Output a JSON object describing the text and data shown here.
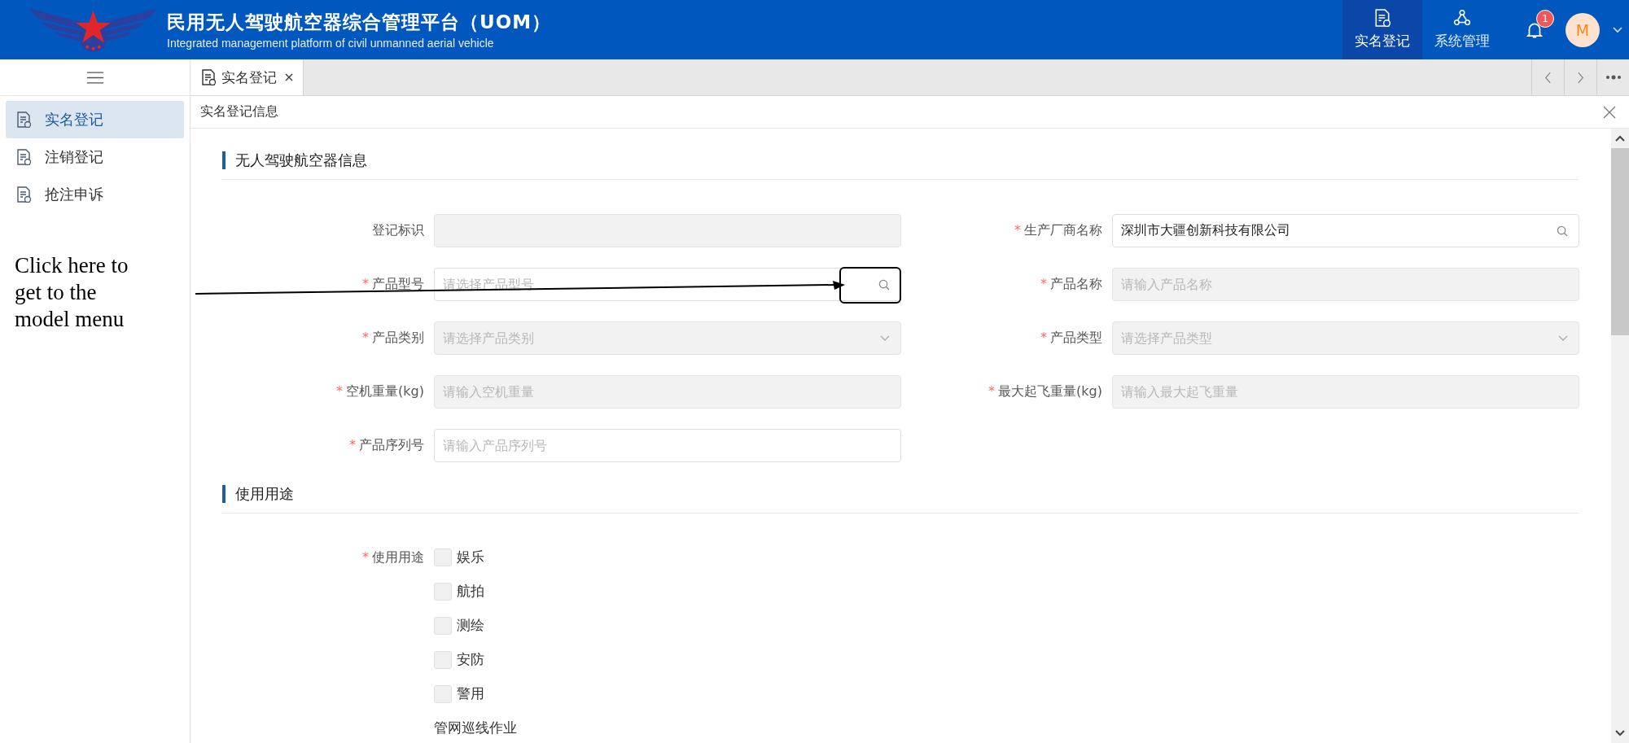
{
  "header": {
    "title": "民用无人驾驶航空器综合管理平台（UOM）",
    "subtitle": "Integrated management platform of civil unmanned aerial vehicle",
    "nav": [
      {
        "label": "实名登记",
        "selected": true,
        "kind": "document"
      },
      {
        "label": "系统管理",
        "selected": false,
        "kind": "network"
      }
    ],
    "notification_count": "1",
    "avatar": "M"
  },
  "sidebar": {
    "items": [
      {
        "label": "实名登记",
        "selected": true
      },
      {
        "label": "注销登记",
        "selected": false
      },
      {
        "label": "抢注申诉",
        "selected": false
      }
    ]
  },
  "tabs": [
    {
      "label": "实名登记",
      "selected": true
    }
  ],
  "page_title": "实名登记信息",
  "sections": [
    {
      "title": "无人驾驶航空器信息",
      "fields": [
        {
          "label": "登记标识",
          "kind": "input",
          "disabled": true
        },
        {
          "label": "生产厂商名称",
          "required_mark": "*",
          "kind": "search",
          "disabled": false,
          "value": "深圳市大疆创新科技有限公司"
        },
        {
          "label": "产品型号",
          "required_mark": "*",
          "kind": "search",
          "disabled": false,
          "placeholder": "请选择产品型号",
          "highlighted": true
        },
        {
          "label": "产品名称",
          "required_mark": "*",
          "kind": "input",
          "disabled": true,
          "placeholder": "请输入产品名称"
        },
        {
          "label": "产品类别",
          "required_mark": "*",
          "kind": "select",
          "disabled": true,
          "placeholder": "请选择产品类别"
        },
        {
          "label": "产品类型",
          "required_mark": "*",
          "kind": "select",
          "disabled": true,
          "placeholder": "请选择产品类型"
        },
        {
          "label": "空机重量(kg)",
          "required_mark": "*",
          "kind": "input",
          "disabled": true,
          "placeholder": "请输入空机重量"
        },
        {
          "label": "最大起飞重量(kg)",
          "required_mark": "*",
          "kind": "input",
          "disabled": true,
          "placeholder": "请输入最大起飞重量"
        },
        {
          "label": "产品序列号",
          "required_mark": "*",
          "kind": "input",
          "disabled": false,
          "placeholder": "请输入产品序列号"
        }
      ]
    },
    {
      "title": "使用用途",
      "fields": [
        {
          "label": "使用用途",
          "required_mark": "*",
          "kind": "checkboxes",
          "options": [
            {
              "label": "娱乐",
              "kind": "checkbox",
              "checked": false
            },
            {
              "label": "航拍",
              "kind": "checkbox",
              "checked": false
            },
            {
              "label": "测绘",
              "kind": "checkbox",
              "checked": false
            },
            {
              "label": "安防",
              "kind": "checkbox",
              "checked": false
            },
            {
              "label": "警用",
              "kind": "checkbox",
              "checked": false
            },
            {
              "label": "管网巡线作业",
              "kind": "text"
            }
          ]
        }
      ]
    }
  ],
  "annotation": {
    "text": "Click here to get to the model menu"
  }
}
